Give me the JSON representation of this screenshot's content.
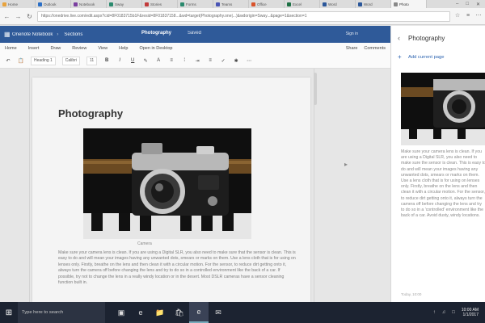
{
  "browser": {
    "tabs": [
      {
        "label": "Home",
        "color": "#e8a33d"
      },
      {
        "label": "Outlook",
        "color": "#2b6fc6"
      },
      {
        "label": "Notebook",
        "color": "#7b3fa0"
      },
      {
        "label": "Sway",
        "color": "#2b8a6e"
      },
      {
        "label": "Stories",
        "color": "#c23b3b"
      },
      {
        "label": "Forms",
        "color": "#2b8a6e"
      },
      {
        "label": "Teams",
        "color": "#4a55b5"
      },
      {
        "label": "Office",
        "color": "#d9532c"
      },
      {
        "label": "Excel",
        "color": "#1e7145"
      },
      {
        "label": "Word",
        "color": "#2b579a"
      },
      {
        "label": "Word",
        "color": "#2b579a"
      },
      {
        "label": "Photo",
        "color": "#888888"
      }
    ],
    "active_tab_index": 11,
    "url": "https://onedrive.live.com/edit.aspx?cid=8F0183715b1F&resid=8F01837158...&wd=target(Photography.one|...)&wdorigin=Sway...&page=1&section=1"
  },
  "app": {
    "crumb_1": "Onenote Notebook",
    "crumb_2": "Sections",
    "doc_title": "Photography",
    "saved_status": "Saved",
    "user": "Sign in"
  },
  "ribbon": {
    "menu": [
      "Home",
      "Insert",
      "Draw",
      "Review",
      "View",
      "Help",
      "Open in Desktop"
    ],
    "menu_right": [
      "Share",
      "Comments"
    ],
    "style_dropdown": "Heading 1",
    "font_dropdown": "Calibri",
    "size_dropdown": "11"
  },
  "page": {
    "title": "Photography",
    "caption": "Camera",
    "body": "Make sure your camera lens is clean. If you are using a Digital SLR, you also need to make sure that the sensor is clean. This is easy to do and will mean your images having any unwanted dots, smears or marks on them. Use a lens cloth that is for using on lenses only. Firstly, breathe on the lens and then clean it with a circular motion. For the sensor, to reduce dirt getting onto it, always turn the camera off before changing the lens and try to do so in a controlled environment like the back of a car. If possible, try not to change the lens in a really windy location or in the desert. Most DSLR cameras have a sensor cleaning function built in."
  },
  "panel": {
    "title": "Photography",
    "add_page": "Add current page",
    "body": "Make sure your camera lens is clean. If you are using a Digital SLR, you also need to make sure the sensor is clean. This is easy to do and will mean your images having any unwanted dots, smears or marks on them. Use a lens cloth that is for using on lenses only. Firstly, breathe on the lens and then clean it with a circular motion. For the sensor, to reduce dirt getting onto it, always turn the camera off before changing the lens and try to do so in a 'controlled' environment like the back of a car. Avoid dusty, windy locations.",
    "date": "Today, 10:00"
  },
  "taskbar": {
    "search_placeholder": "Type here to search",
    "time": "10:00 AM",
    "date": "1/1/2017"
  }
}
